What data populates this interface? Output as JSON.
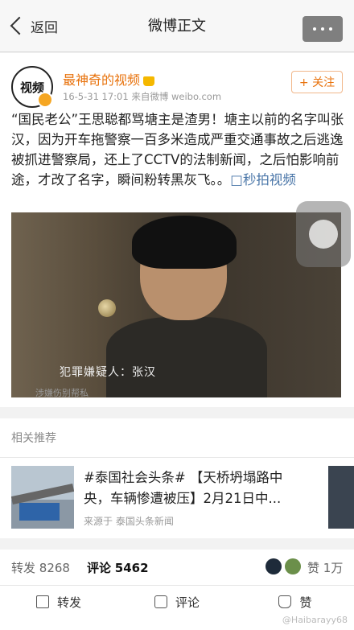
{
  "header": {
    "back_label": "返回",
    "title": "微博正文"
  },
  "post": {
    "avatar_text": "视频",
    "username": "最神奇的视频",
    "meta": "16-5-31 17:01  来自微博 weibo.com",
    "follow_label": "+ 关注",
    "text": "“国民老公”王思聪都骂塘主是渣男！塘主以前的名字叫张汉，因为开车拖警察一百多米造成严重交通事故之后逃逸被抓进警察局，还上了CCTV的法制新闻，之后怕影响前途，才改了名字，瞬间粉转黑灰飞。。",
    "link_text": "□秒拍视频",
    "video_caption": "犯罪嫌疑人：张汉",
    "video_caption_partial": "涉嫌伤别帮私"
  },
  "related": {
    "heading": "相关推荐",
    "item": {
      "title_line1": "#泰国社会头条# 【天桥坍塌路中",
      "title_line2": "央，车辆惨遭被压】2月21日中...",
      "source": "来源于 泰国头条新闻"
    }
  },
  "stats": {
    "repost_label": "转发",
    "repost_count": "8268",
    "comment_label": "评论",
    "comment_count": "5462",
    "like_label": "赞",
    "like_count": "1万"
  },
  "actions": {
    "repost": "转发",
    "comment": "评论",
    "like": "赞"
  },
  "watermark": "@Haibarayy68",
  "colors": {
    "accent": "#e8720c",
    "link": "#4a76a8"
  }
}
